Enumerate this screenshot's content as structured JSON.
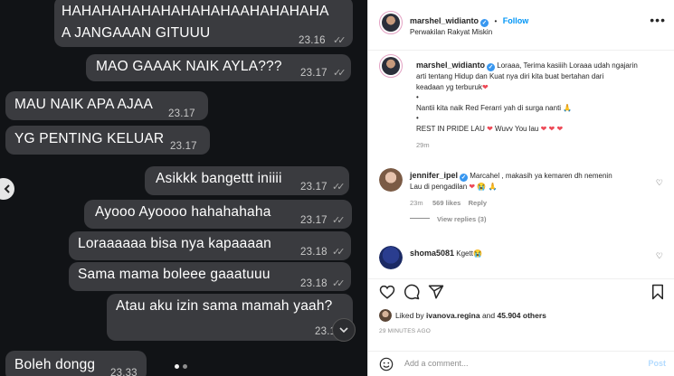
{
  "chat": {
    "messages": [
      {
        "text": "HAHAHAHAHAHAHAHAHAAHAHAHAHA",
        "text2": "A JANGAAAN GITUUU",
        "time": "23.16",
        "ticks": "✓✓"
      },
      {
        "text": "MAO GAAAK NAIK AYLA???",
        "time": "23.17",
        "ticks": "✓✓"
      },
      {
        "text": "MAU NAIK APA AJAA",
        "time": "23.17"
      },
      {
        "text": "YG PENTING KELUAR",
        "time": "23.17"
      },
      {
        "text": "Asikkk bangettt iniiii",
        "time": "23.17",
        "ticks": "✓✓"
      },
      {
        "text": "Ayooo Ayoooo hahahahaha",
        "time": "23.17",
        "ticks": "✓✓"
      },
      {
        "text": "Loraaaaaa bisa nya kapaaaan",
        "time": "23.18",
        "ticks": "✓✓"
      },
      {
        "text": "Sama mama boleee gaaatuuu",
        "time": "23.18",
        "ticks": "✓✓"
      },
      {
        "text": "Atau aku izin sama mamah yaah?",
        "time": "23.1"
      },
      {
        "text": "Boleh dongg",
        "time": "23.33"
      }
    ]
  },
  "post": {
    "author": "marshel_widianto",
    "follow_label": "Follow",
    "location": "Perwakilan Rakyat Miskin",
    "caption_author": "marshel_widianto",
    "caption_lines": [
      "Loraaa, Terima kasiiih Loraaa udah ngajarin",
      "arti tentang Hidup dan Kuat nya diri kita buat bertahan dari",
      "keadaan yg terburuk",
      "•",
      "Nantii kita naik Red Ferarri yah di surga nanti",
      "•",
      "REST IN PRIDE LAU",
      "Wuvv You lau"
    ],
    "caption_time": "29m",
    "comments": [
      {
        "user": "jennifer_ipel",
        "text": "Marcahel , makasih ya kemaren dh nemenin",
        "text2": "Lau di pengadilan",
        "time": "23m",
        "likes": "569 likes",
        "reply": "Reply",
        "view_replies": "View replies (3)"
      },
      {
        "user": "shoma5081",
        "text": "Kgett",
        "time": "",
        "likes": "",
        "reply": "",
        "view_replies": ""
      }
    ],
    "likes_prefix": "Liked by",
    "likes_user": "ivanova.regina",
    "likes_and": "and",
    "likes_count": "45.904 others",
    "posted_ago": "29 MINUTES AGO",
    "comment_placeholder": "Add a comment...",
    "post_button": "Post"
  },
  "colors": {
    "accent": "#0095f6",
    "chat_bg": "#111316",
    "bubble": "#3a3b3f",
    "heart": "#ed4956"
  }
}
